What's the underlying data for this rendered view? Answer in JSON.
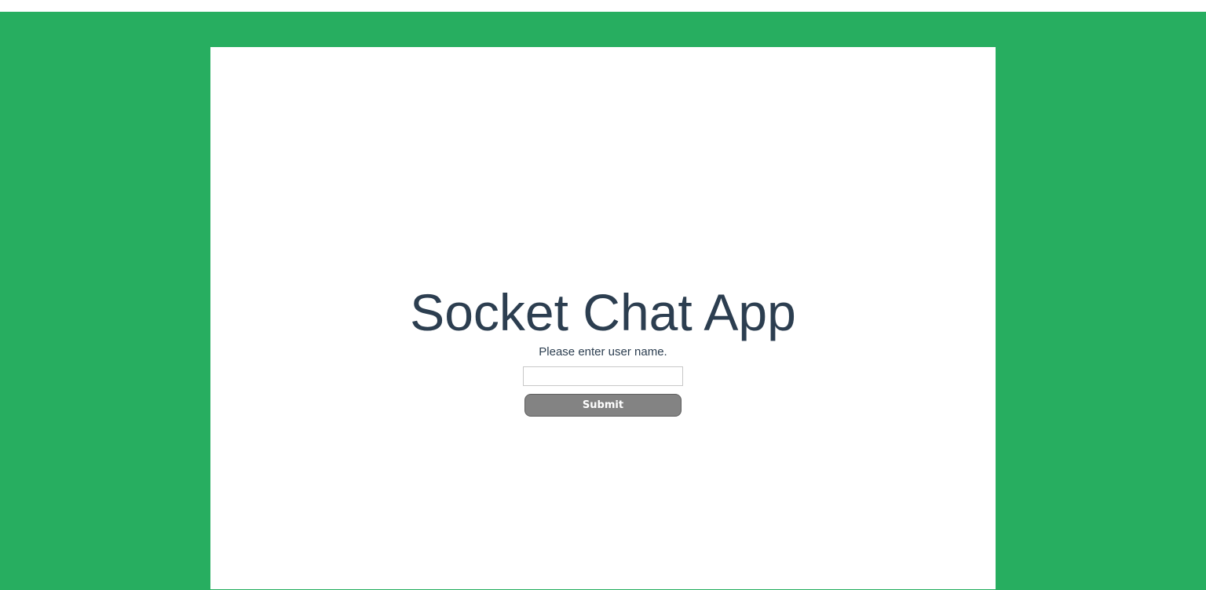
{
  "app": {
    "title": "Socket Chat App",
    "prompt": "Please enter user name.",
    "username_field": {
      "value": "",
      "placeholder": ""
    },
    "submit_label": "Submit"
  },
  "colors": {
    "background": "#27ae60",
    "card": "#ffffff",
    "title_text": "#2c3e50",
    "button": "#838383",
    "button_text": "#ffffff"
  }
}
